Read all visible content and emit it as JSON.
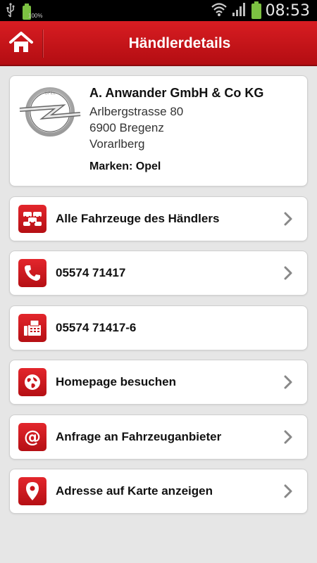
{
  "statusbar": {
    "time": "08:53",
    "battery_small_label": "100%"
  },
  "appbar": {
    "title": "Händlerdetails"
  },
  "dealer": {
    "name": "A. Anwander GmbH & Co KG",
    "street": "Arlbergstrasse 80",
    "city": "6900 Bregenz",
    "region": "Vorarlberg",
    "brands": "Marken: Opel",
    "logo_text": "OPEL"
  },
  "actions": [
    {
      "label": "Alle Fahrzeuge des Händlers",
      "icon": "cars-icon"
    },
    {
      "label": "05574 71417",
      "icon": "phone-icon"
    },
    {
      "label": "05574 71417-6",
      "icon": "fax-icon"
    },
    {
      "label": "Homepage besuchen",
      "icon": "globe-icon"
    },
    {
      "label": "Anfrage an Fahrzeuganbieter",
      "icon": "at-icon"
    },
    {
      "label": "Adresse auf Karte anzeigen",
      "icon": "map-pin-icon"
    }
  ],
  "colors": {
    "accent": "#c8141a",
    "background": "#e6e6e6",
    "card": "#ffffff"
  }
}
